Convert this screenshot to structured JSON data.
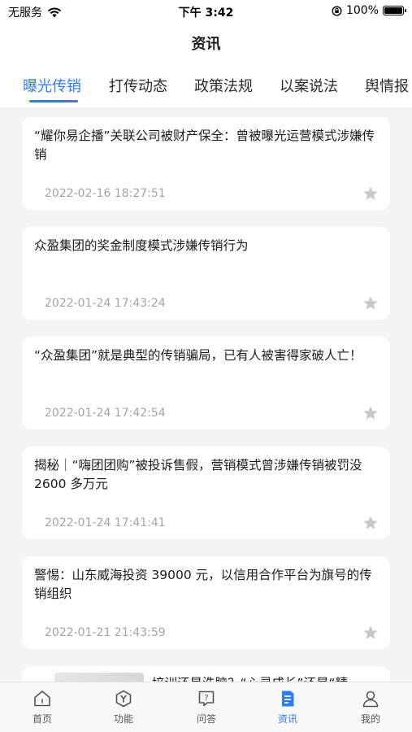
{
  "status_bar": {
    "carrier": "无服务",
    "time": "下午 3:42",
    "battery": "100%",
    "battery_level": 1.0
  },
  "header": {
    "title": "资讯"
  },
  "tabs": [
    {
      "label": "曝光传销",
      "active": true
    },
    {
      "label": "打传动态",
      "active": false
    },
    {
      "label": "政策法规",
      "active": false
    },
    {
      "label": "以案说法",
      "active": false
    },
    {
      "label": "舆情报",
      "active": false
    }
  ],
  "articles": [
    {
      "title": "“耀你易企播”关联公司被财产保全：曾被曝光运营模式涉嫌传销",
      "time": "2022-02-16 18:27:51"
    },
    {
      "title": "众盈集团的奖金制度模式涉嫌传销行为",
      "time": "2022-01-24 17:43:24"
    },
    {
      "title": "“众盈集团”就是典型的传销骗局，已有人被害得家破人亡！",
      "time": "2022-01-24 17:42:54"
    },
    {
      "title": "揭秘｜“嗨团团购”被投诉售假，营销模式曾涉嫌传销被罚没 2600 多万元",
      "time": "2022-01-24 17:41:41"
    },
    {
      "title": "警惕：山东威海投资 39000 元，以信用合作平台为旗号的传销组织",
      "time": "2022-01-21 21:43:59"
    }
  ],
  "partial_article": {
    "title": "培训还是洗脑？“心灵成长”还是“精"
  },
  "tabbar": [
    {
      "label": "首页",
      "icon": "home-icon",
      "active": false
    },
    {
      "label": "功能",
      "icon": "function-icon",
      "active": false
    },
    {
      "label": "问答",
      "icon": "qa-icon",
      "active": false
    },
    {
      "label": "资讯",
      "icon": "news-icon",
      "active": true
    },
    {
      "label": "我的",
      "icon": "profile-icon",
      "active": false
    }
  ],
  "colors": {
    "accent": "#2f7bff",
    "background": "#f3f4f7",
    "muted_text": "#a0a4ab",
    "star": "#c8c8cc"
  }
}
